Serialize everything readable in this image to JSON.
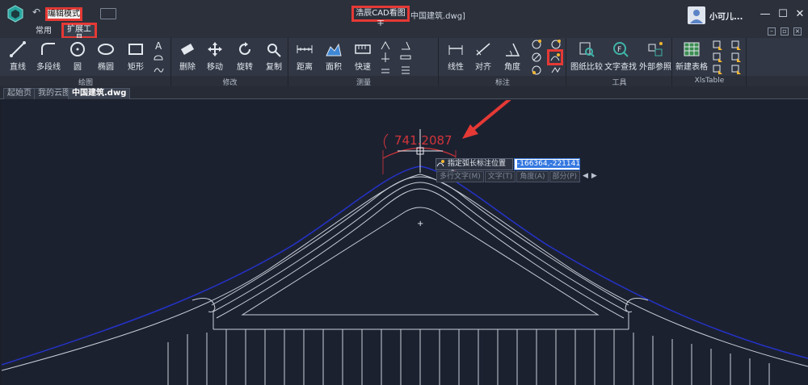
{
  "titlebar": {
    "mode_label": "编辑模式",
    "app_name": "浩辰CAD看图王",
    "file_title": "中国建筑.dwg]",
    "user_name": "小可儿..."
  },
  "tabs": [
    {
      "label": "常用"
    },
    {
      "label": "扩展工具"
    }
  ],
  "ribbon": {
    "groups": [
      {
        "label": "绘图"
      },
      {
        "label": "修改"
      },
      {
        "label": "测量"
      },
      {
        "label": "标注"
      },
      {
        "label": "工具"
      },
      {
        "label": "XlsTable"
      }
    ],
    "draw": [
      "直线",
      "多段线",
      "圆",
      "椭圆",
      "矩形"
    ],
    "modify": [
      "删除",
      "移动",
      "旋转",
      "复制"
    ],
    "measure": [
      "距离",
      "面积",
      "快速"
    ],
    "annotate": [
      "线性",
      "对齐",
      "角度"
    ],
    "tools": [
      "图纸比较",
      "文字查找",
      "外部参照"
    ],
    "xls": [
      "新建表格"
    ]
  },
  "doc_tabs": [
    {
      "label": "起始页"
    },
    {
      "label": "我的云图"
    },
    {
      "label": "中国建筑.dwg"
    }
  ],
  "drawing": {
    "dimension_value": "741.2087",
    "prompt_text": "指定弧长标注位置或",
    "coord_value": "-166364,-221141",
    "options": [
      "多行文字(M)",
      "文字(T)",
      "角度(A)",
      "部分(P)"
    ]
  },
  "colors": {
    "annotation_red": "#e53935",
    "canvas_bg": "#1c2130",
    "roof_blue": "#2433c9",
    "dimension_red": "#d1353b"
  }
}
